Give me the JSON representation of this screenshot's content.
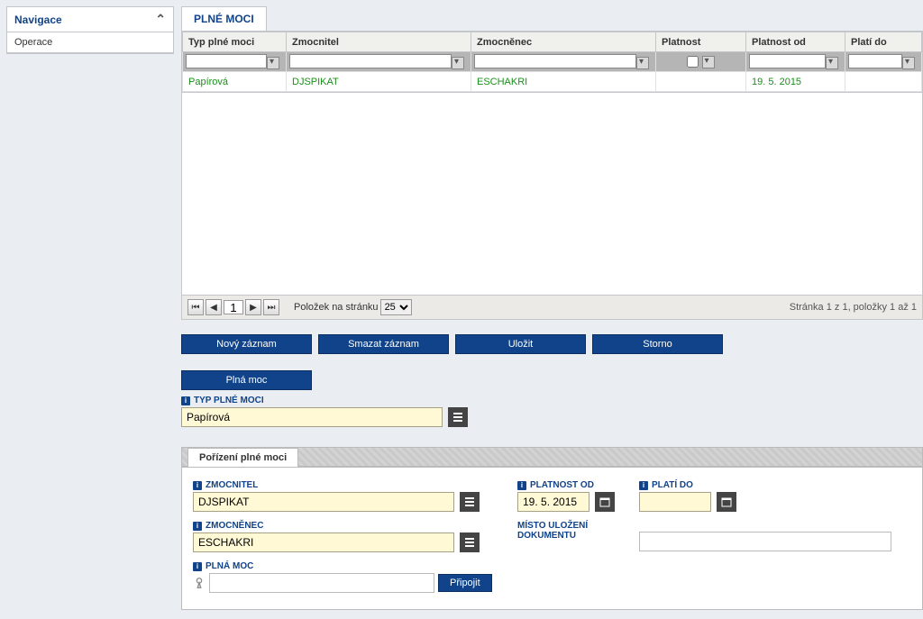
{
  "sidebar": {
    "header": "Navigace",
    "items": [
      "Operace"
    ]
  },
  "tabs": {
    "main": "PLNÉ MOCI"
  },
  "grid": {
    "headers": {
      "typ": "Typ plné moci",
      "zmocnitel": "Zmocnitel",
      "zmocnenec": "Zmocněnec",
      "platnost": "Platnost",
      "platnost_od": "Platnost od",
      "plati_do": "Platí do"
    },
    "row": {
      "typ": "Papírová",
      "zmocnitel": "DJSPIKAT",
      "zmocnenec": "ESCHAKRI",
      "platnost": "",
      "platnost_od": "19. 5. 2015",
      "plati_do": ""
    }
  },
  "pager": {
    "page": "1",
    "per_page_label": "Položek na stránku",
    "per_page": "25",
    "status": "Stránka 1 z 1, položky 1 až 1"
  },
  "buttons": {
    "novy": "Nový záznam",
    "smazat": "Smazat záznam",
    "ulozit": "Uložit",
    "storno": "Storno",
    "plna_moc": "Plná moc",
    "pripojit": "Připojit"
  },
  "form": {
    "typ_label": "TYP PLNÉ MOCI",
    "typ_value": "Papírová",
    "inner_tab": "Pořízení plné moci",
    "zmocnitel_label": "ZMOCNITEL",
    "zmocnitel_value": "DJSPIKAT",
    "zmocnenec_label": "ZMOCNĚNEC",
    "zmocnenec_value": "ESCHAKRI",
    "platnost_od_label": "PLATNOST OD",
    "platnost_od_value": "19. 5. 2015",
    "plati_do_label": "PLATÍ DO",
    "plati_do_value": "",
    "misto_label": "MÍSTO ULOŽENÍ DOKUMENTU",
    "misto_value": "",
    "plna_moc_label": "PLNÁ MOC"
  }
}
